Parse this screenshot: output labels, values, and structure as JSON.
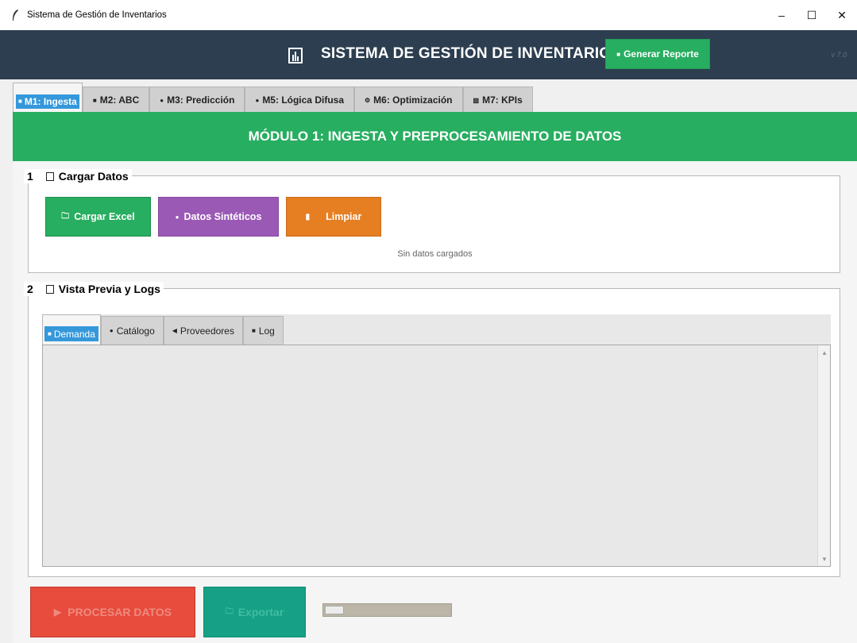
{
  "window": {
    "title": "Sistema de Gestión de Inventarios",
    "minimize": "–",
    "maximize": "☐",
    "close": "✕"
  },
  "header": {
    "title": "SISTEMA DE GESTIÓN DE INVENTARIOS",
    "report_button": "Generar Reporte",
    "version": "v 7.0"
  },
  "main_tabs": [
    {
      "label": "M1: Ingesta",
      "icon": "box-icon",
      "glyph": "■",
      "active": true
    },
    {
      "label": "M2: ABC",
      "icon": "chart-icon",
      "glyph": "■"
    },
    {
      "label": "M3: Predicción",
      "icon": "dot-icon",
      "glyph": "●"
    },
    {
      "label": "M5: Lógica Difusa",
      "icon": "brain-icon",
      "glyph": "●"
    },
    {
      "label": "M6: Optimización",
      "icon": "gear-icon",
      "glyph": "⚙"
    },
    {
      "label": "M7: KPIs",
      "icon": "chart-icon",
      "glyph": "▨"
    }
  ],
  "module": {
    "banner": "MÓDULO 1: INGESTA Y PREPROCESAMIENTO DE DATOS",
    "section1": {
      "number": "1",
      "title": "Cargar Datos",
      "load_excel": "Cargar Excel",
      "synthetic": "Datos Sintéticos",
      "clear": "Limpiar",
      "status": "Sin datos cargados"
    },
    "section2": {
      "number": "2",
      "title": "Vista Previa y Logs",
      "tabs": [
        {
          "label": "Demanda",
          "icon": "box-icon",
          "glyph": "■",
          "active": true
        },
        {
          "label": "Catálogo",
          "icon": "book-icon",
          "glyph": "●"
        },
        {
          "label": "Proveedores",
          "icon": "truck-icon",
          "glyph": "◀"
        },
        {
          "label": "Log",
          "icon": "log-icon",
          "glyph": "■"
        }
      ]
    }
  },
  "footer": {
    "process": "PROCESAR DATOS",
    "export": "Exportar",
    "progress": 0.1
  },
  "colors": {
    "header_bg": "#2c3e50",
    "green": "#27ae60",
    "purple": "#9b59b6",
    "orange": "#e67e22",
    "red": "#e74c3c",
    "teal": "#16a085",
    "blue": "#3498db"
  }
}
